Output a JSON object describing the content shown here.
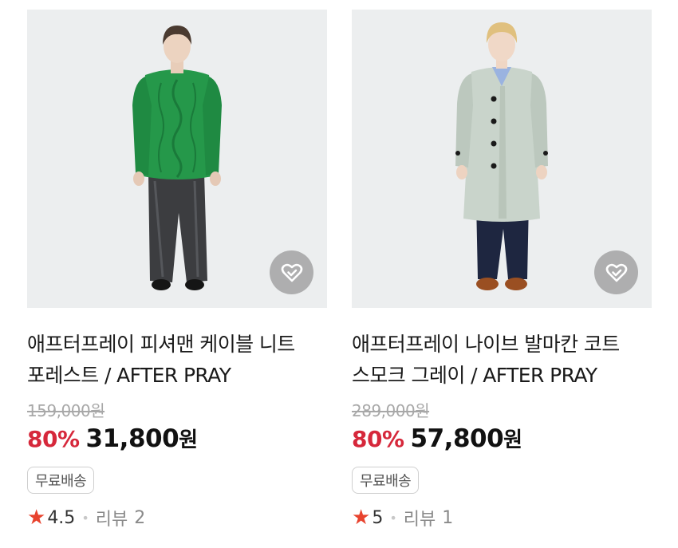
{
  "products": [
    {
      "title": "애프터프레이 피셔맨 케이블 니트 포레스트 / AFTER PRAY",
      "original_price": "159,000원",
      "discount": "80%",
      "sale_price": "31,800",
      "currency": "원",
      "badge": "무료배송",
      "rating": "4.5",
      "review_label": "리뷰",
      "review_count": "2",
      "sweater_color": "#25984a"
    },
    {
      "title": "애프터프레이 나이브 발마칸 코트 스모크 그레이 / AFTER PRAY",
      "original_price": "289,000원",
      "discount": "80%",
      "sale_price": "57,800",
      "currency": "원",
      "badge": "무료배송",
      "rating": "5",
      "review_label": "리뷰",
      "review_count": "1",
      "coat_color": "#c9d4cb"
    }
  ],
  "icons": {
    "wishlist": "heart-check-icon",
    "rating": "star-icon"
  },
  "colors": {
    "discount": "#d6283b",
    "star": "#e8432e"
  }
}
